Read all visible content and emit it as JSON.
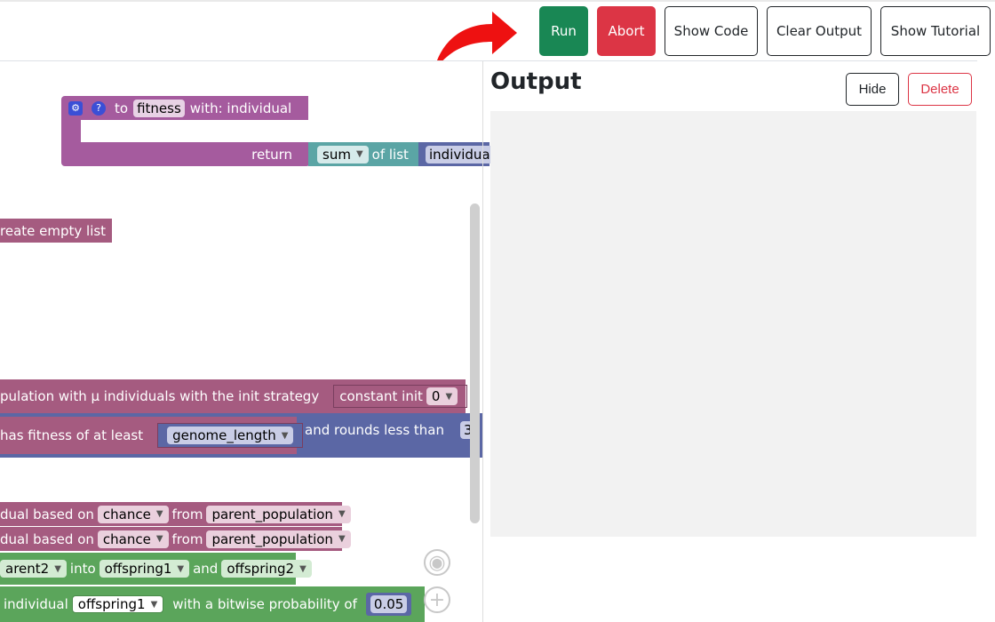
{
  "toolbar": {
    "run_label": "Run",
    "abort_label": "Abort",
    "show_code_label": "Show Code",
    "clear_output_label": "Clear Output",
    "show_tutorial_label": "Show Tutorial"
  },
  "workspace": {
    "fitness_block": {
      "to_label": "to",
      "name": "fitness",
      "with_label": "with: individual",
      "return_label": "return"
    },
    "sum_block": {
      "op": "sum",
      "of_label": "of list"
    },
    "list_var": "individua",
    "create_list": "reate empty list",
    "init_population": {
      "text": "pulation with μ individuals  with the init strategy",
      "strategy": "constant init",
      "value": "0"
    },
    "condition": {
      "text": "has fitness of at least",
      "var": "genome_length",
      "rounds_text": "and rounds less than",
      "rounds_value": "3"
    },
    "select1": {
      "prefix": "dual based on",
      "method": "chance",
      "from_label": "from",
      "pop": "parent_population"
    },
    "select2": {
      "prefix": "dual based on",
      "method": "chance",
      "from_label": "from",
      "pop": "parent_population"
    },
    "crossover": {
      "parent": "arent2",
      "into_label": "into",
      "child1": "offspring1",
      "and_label": "and",
      "child2": "offspring2"
    },
    "mutation": {
      "prefix": "individual",
      "target": "offspring1",
      "text": "with a bitwise probability of",
      "prob": "0.05"
    }
  },
  "output": {
    "title": "Output",
    "hide_label": "Hide",
    "delete_label": "Delete"
  },
  "colors": {
    "run": "#198754",
    "abort": "#dc3545",
    "procedure": "#a55b9e",
    "list": "#a55b80",
    "logic": "#5b67a5",
    "math": "#5ba5a5",
    "evo": "#5ba55b"
  }
}
